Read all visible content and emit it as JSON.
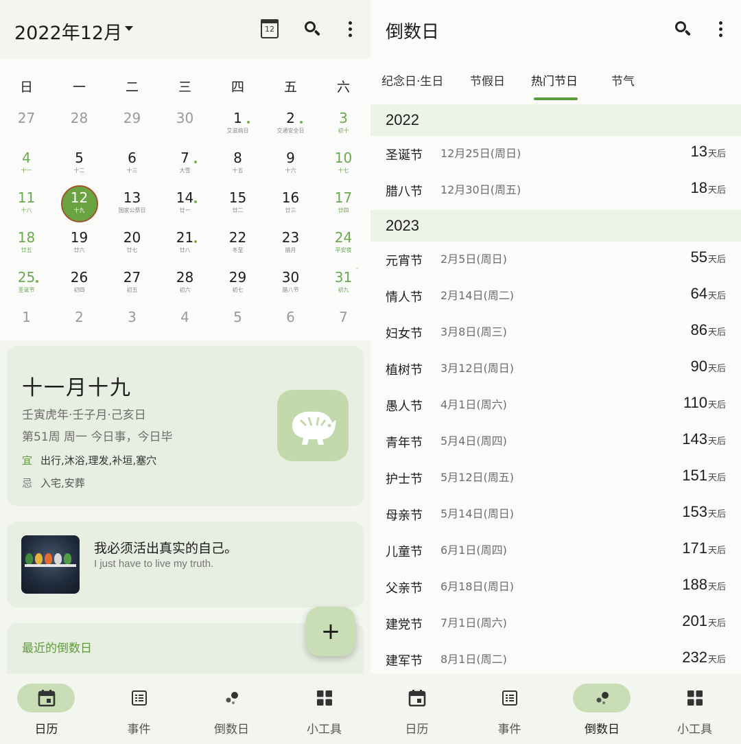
{
  "left": {
    "header": {
      "month_title": "2022年12月",
      "today_icon_num": "12"
    },
    "weekdays": [
      "日",
      "一",
      "二",
      "三",
      "四",
      "五",
      "六"
    ],
    "weeks": [
      [
        {
          "d": "27",
          "l": "",
          "muted": true
        },
        {
          "d": "28",
          "l": "",
          "muted": true
        },
        {
          "d": "29",
          "l": "",
          "muted": true
        },
        {
          "d": "30",
          "l": "",
          "muted": true
        },
        {
          "d": "1",
          "l": "艾滋病日",
          "dot": true
        },
        {
          "d": "2",
          "l": "交通安全日",
          "dot": true
        },
        {
          "d": "3",
          "l": "初十",
          "weekend": true
        }
      ],
      [
        {
          "d": "4",
          "l": "十一",
          "weekend": true
        },
        {
          "d": "5",
          "l": "十二"
        },
        {
          "d": "6",
          "l": "十三"
        },
        {
          "d": "7",
          "l": "大雪",
          "dot": true
        },
        {
          "d": "8",
          "l": "十五"
        },
        {
          "d": "9",
          "l": "十六"
        },
        {
          "d": "10",
          "l": "十七",
          "weekend": true
        }
      ],
      [
        {
          "d": "11",
          "l": "十八",
          "weekend": true
        },
        {
          "d": "12",
          "l": "十九",
          "today": true
        },
        {
          "d": "13",
          "l": "国家公祭日"
        },
        {
          "d": "14",
          "l": "廿一",
          "dot": true
        },
        {
          "d": "15",
          "l": "廿二"
        },
        {
          "d": "16",
          "l": "廿三"
        },
        {
          "d": "17",
          "l": "廿四",
          "weekend": true
        }
      ],
      [
        {
          "d": "18",
          "l": "廿五",
          "weekend": true
        },
        {
          "d": "19",
          "l": "廿六"
        },
        {
          "d": "20",
          "l": "廿七"
        },
        {
          "d": "21",
          "l": "廿八",
          "dot": true
        },
        {
          "d": "22",
          "l": "冬至"
        },
        {
          "d": "23",
          "l": "腊月"
        },
        {
          "d": "24",
          "l": "平安夜",
          "weekend": true
        }
      ],
      [
        {
          "d": "25",
          "l": "圣诞节",
          "weekend": true,
          "dot": true
        },
        {
          "d": "26",
          "l": "初四"
        },
        {
          "d": "27",
          "l": "初五"
        },
        {
          "d": "28",
          "l": "初六"
        },
        {
          "d": "29",
          "l": "初七"
        },
        {
          "d": "30",
          "l": "腊八节"
        },
        {
          "d": "31",
          "l": "初九",
          "weekend": true,
          "mark": "″"
        }
      ],
      [
        {
          "d": "1",
          "l": "",
          "muted": true
        },
        {
          "d": "2",
          "l": "",
          "muted": true
        },
        {
          "d": "3",
          "l": "",
          "muted": true
        },
        {
          "d": "4",
          "l": "",
          "muted": true
        },
        {
          "d": "5",
          "l": "",
          "muted": true
        },
        {
          "d": "6",
          "l": "",
          "muted": true
        },
        {
          "d": "7",
          "l": "",
          "muted": true
        }
      ]
    ],
    "lunar": {
      "title": "十一月十九",
      "ganzhi": "壬寅虎年·壬子月·己亥日",
      "week_info": "第51周 周一 今日事，今日毕",
      "yi_key": "宜",
      "yi": "出行,沐浴,理发,补垣,塞穴",
      "ji_key": "忌",
      "ji": "入宅,安葬"
    },
    "quote": {
      "zh": "我必须活出真实的自己。",
      "en": "I just have to live my truth."
    },
    "recent": {
      "title": "最近的倒数日"
    },
    "fab": "+",
    "nav": [
      {
        "label": "日历",
        "icon": "calendar-icon",
        "active": true
      },
      {
        "label": "事件",
        "icon": "list-icon"
      },
      {
        "label": "倒数日",
        "icon": "countdown-icon"
      },
      {
        "label": "小工具",
        "icon": "widgets-icon"
      }
    ]
  },
  "right": {
    "title": "倒数日",
    "tabs": [
      "纪念日·生日",
      "节假日",
      "热门节日",
      "节气"
    ],
    "active_tab": "热门节日",
    "unit": "天后",
    "groups": [
      {
        "year": "2022",
        "items": [
          {
            "name": "圣诞节",
            "date": "12月25日(周日)",
            "days": "13"
          },
          {
            "name": "腊八节",
            "date": "12月30日(周五)",
            "days": "18"
          }
        ]
      },
      {
        "year": "2023",
        "items": [
          {
            "name": "元宵节",
            "date": "2月5日(周日)",
            "days": "55"
          },
          {
            "name": "情人节",
            "date": "2月14日(周二)",
            "days": "64"
          },
          {
            "name": "妇女节",
            "date": "3月8日(周三)",
            "days": "86"
          },
          {
            "name": "植树节",
            "date": "3月12日(周日)",
            "days": "90"
          },
          {
            "name": "愚人节",
            "date": "4月1日(周六)",
            "days": "110"
          },
          {
            "name": "青年节",
            "date": "5月4日(周四)",
            "days": "143"
          },
          {
            "name": "护士节",
            "date": "5月12日(周五)",
            "days": "151"
          },
          {
            "name": "母亲节",
            "date": "5月14日(周日)",
            "days": "153"
          },
          {
            "name": "儿童节",
            "date": "6月1日(周四)",
            "days": "171"
          },
          {
            "name": "父亲节",
            "date": "6月18日(周日)",
            "days": "188"
          },
          {
            "name": "建党节",
            "date": "7月1日(周六)",
            "days": "201"
          },
          {
            "name": "建军节",
            "date": "8月1日(周二)",
            "days": "232"
          }
        ]
      }
    ],
    "nav": [
      {
        "label": "日历",
        "icon": "calendar-icon"
      },
      {
        "label": "事件",
        "icon": "list-icon"
      },
      {
        "label": "倒数日",
        "icon": "countdown-icon",
        "active": true
      },
      {
        "label": "小工具",
        "icon": "widgets-icon"
      }
    ]
  },
  "colors": {
    "accent_green": "#5c9c3b",
    "weekend_green": "#6aa84f",
    "today_fill": "#6aa442",
    "pill": "#c9ddb6",
    "card": "#e8eee1"
  }
}
